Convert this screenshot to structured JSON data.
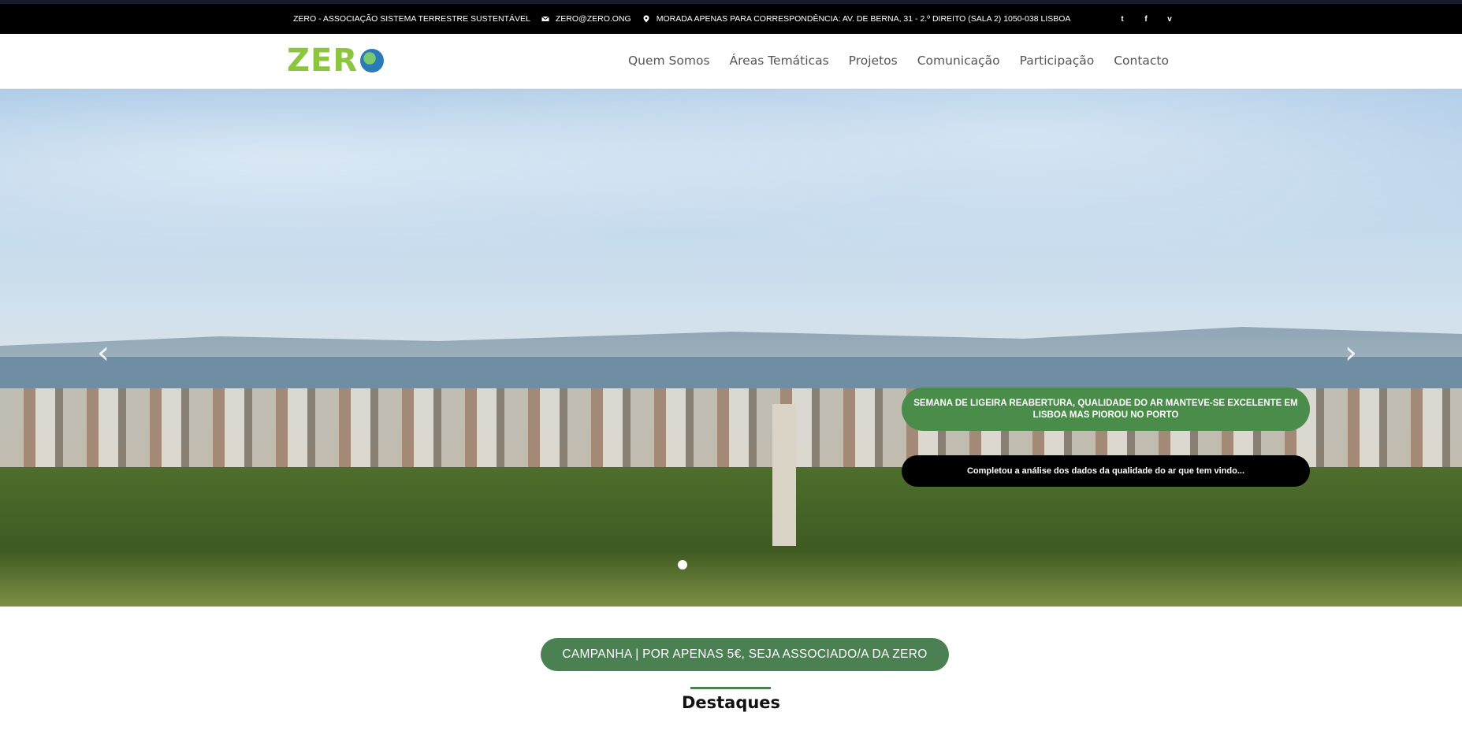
{
  "topbar": {
    "org_name": "ZERO - ASSOCIAÇÃO SISTEMA TERRESTRE SUSTENTÁVEL",
    "email": "ZERO@ZERO.ONG",
    "address": "MORADA APENAS PARA CORRESPONDÊNCIA: AV. DE BERNA, 31 - 2.º DIREITO (SALA 2) 1050-038 LISBOA",
    "social": [
      "twitter-icon",
      "facebook-icon",
      "vimeo-icon"
    ]
  },
  "header": {
    "logo_text": "ZER",
    "nav": [
      {
        "label": "Quem Somos"
      },
      {
        "label": "Áreas Temáticas"
      },
      {
        "label": "Projetos"
      },
      {
        "label": "Comunicação"
      },
      {
        "label": "Participação"
      },
      {
        "label": "Contacto"
      }
    ]
  },
  "hero": {
    "caption_title": "SEMANA DE LIGEIRA REABERTURA, QUALIDADE DO AR MANTEVE-SE EXCELENTE EM LISBOA MAS PIOROU NO PORTO",
    "caption_text": "Completou a análise dos dados da qualidade do ar que tem vindo..."
  },
  "campaign": {
    "label": "CAMPANHA | POR APENAS 5€, SEJA ASSOCIADO/A DA ZERO"
  },
  "section": {
    "title": "Destaques"
  },
  "colors": {
    "green": "#4a8052",
    "logo_green": "#8cc63f",
    "topbar_bg": "#000000"
  }
}
